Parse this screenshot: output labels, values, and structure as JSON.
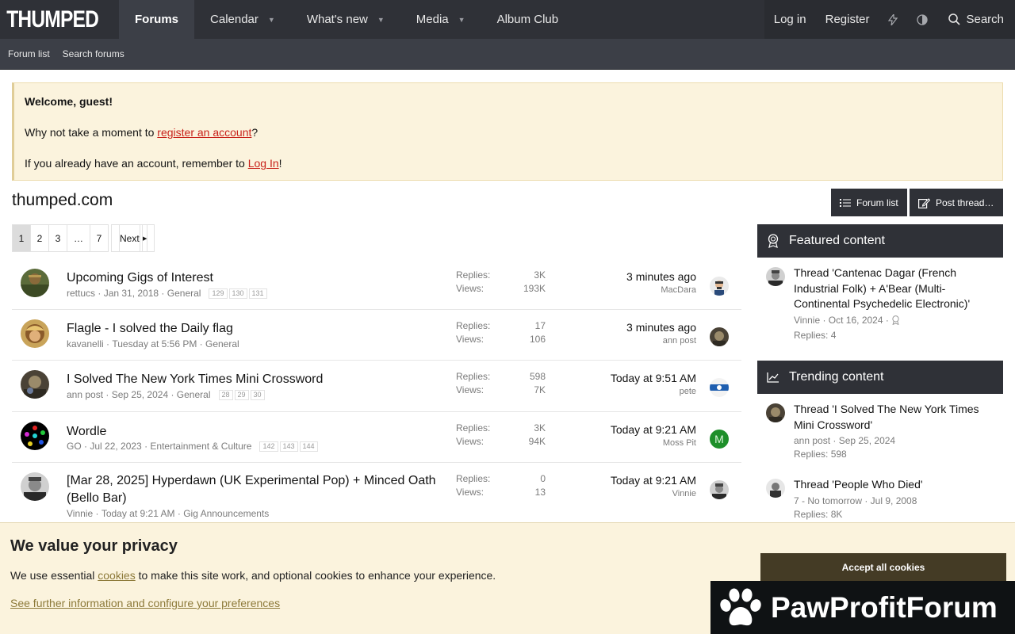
{
  "nav": {
    "logo": "THUMPED",
    "items": [
      "Forums",
      "Calendar",
      "What's new",
      "Media",
      "Album Club"
    ],
    "login": "Log in",
    "register": "Register",
    "search": "Search"
  },
  "subnav": [
    "Forum list",
    "Search forums"
  ],
  "notice": {
    "welcome": "Welcome, guest!",
    "line1_pre": "Why not take a moment to ",
    "line1_link": "register an account",
    "line1_post": "?",
    "line2_pre": "If you already have an account, remember to ",
    "line2_link": "Log In",
    "line2_post": "!"
  },
  "page_title": "thumped.com",
  "buttons": {
    "forum_list": "Forum list",
    "post_thread": "Post thread…"
  },
  "pager": {
    "pages": [
      "1",
      "2",
      "3",
      "…",
      "7"
    ],
    "next": "Next"
  },
  "stats_labels": {
    "replies": "Replies:",
    "views": "Views:"
  },
  "threads": [
    {
      "title": "Upcoming Gigs of Interest",
      "author": "rettucs",
      "date": "Jan 31, 2018",
      "forum": "General",
      "pages": [
        "129",
        "130",
        "131"
      ],
      "replies": "3K",
      "views": "193K",
      "last_time": "3 minutes ago",
      "last_user": "MacDara"
    },
    {
      "title": "Flagle - I solved the Daily flag",
      "author": "kavanelli",
      "date": "Tuesday at 5:56 PM",
      "forum": "General",
      "pages": [],
      "replies": "17",
      "views": "106",
      "last_time": "3 minutes ago",
      "last_user": "ann post"
    },
    {
      "title": "I Solved The New York Times Mini Crossword",
      "author": "ann post",
      "date": "Sep 25, 2024",
      "forum": "General",
      "pages": [
        "28",
        "29",
        "30"
      ],
      "replies": "598",
      "views": "7K",
      "last_time": "Today at 9:51 AM",
      "last_user": "pete"
    },
    {
      "title": "Wordle",
      "author": "GO",
      "date": "Jul 22, 2023",
      "forum": "Entertainment & Culture",
      "pages": [
        "142",
        "143",
        "144"
      ],
      "replies": "3K",
      "views": "94K",
      "last_time": "Today at 9:21 AM",
      "last_user": "Moss Pit"
    },
    {
      "title": "[Mar 28, 2025] Hyperdawn (UK Experimental Pop) + Minced Oath (Bello Bar)",
      "author": "Vinnie",
      "date": "Today at 9:21 AM",
      "forum": "Gig Announcements",
      "pages": [],
      "replies": "0",
      "views": "13",
      "last_time": "Today at 9:21 AM",
      "last_user": "Vinnie"
    }
  ],
  "featured": {
    "heading": "Featured content",
    "items": [
      {
        "title": "Thread 'Cantenac Dagar (French Industrial Folk) + A'Bear (Multi-Continental Psychedelic Electronic)'",
        "meta": "Vinnie · Oct 16, 2024 ·",
        "replies": "Replies: 4"
      }
    ]
  },
  "trending": {
    "heading": "Trending content",
    "items": [
      {
        "title": "Thread 'I Solved The New York Times Mini Crossword'",
        "meta": "ann post · Sep 25, 2024",
        "replies": "Replies: 598"
      },
      {
        "title": "Thread 'People Who Died'",
        "meta": "7 - No tomorrow · Jul 9, 2008",
        "replies": "Replies: 8K"
      }
    ]
  },
  "cookie": {
    "heading": "We value your privacy",
    "text_pre": "We use essential ",
    "text_link": "cookies",
    "text_post": " to make this site work, and optional cookies to enhance your experience.",
    "further": "See further information and configure your preferences",
    "accept": "Accept all cookies"
  },
  "watermark": "PawProfitForum",
  "avatar_initial_go": "M",
  "colors": {
    "nav_bg": "#2f3137",
    "subnav_bg": "#3c3f47",
    "notice_bg": "#fbf3dd",
    "link_red": "#c8211a",
    "accept_bg": "#443b25"
  }
}
